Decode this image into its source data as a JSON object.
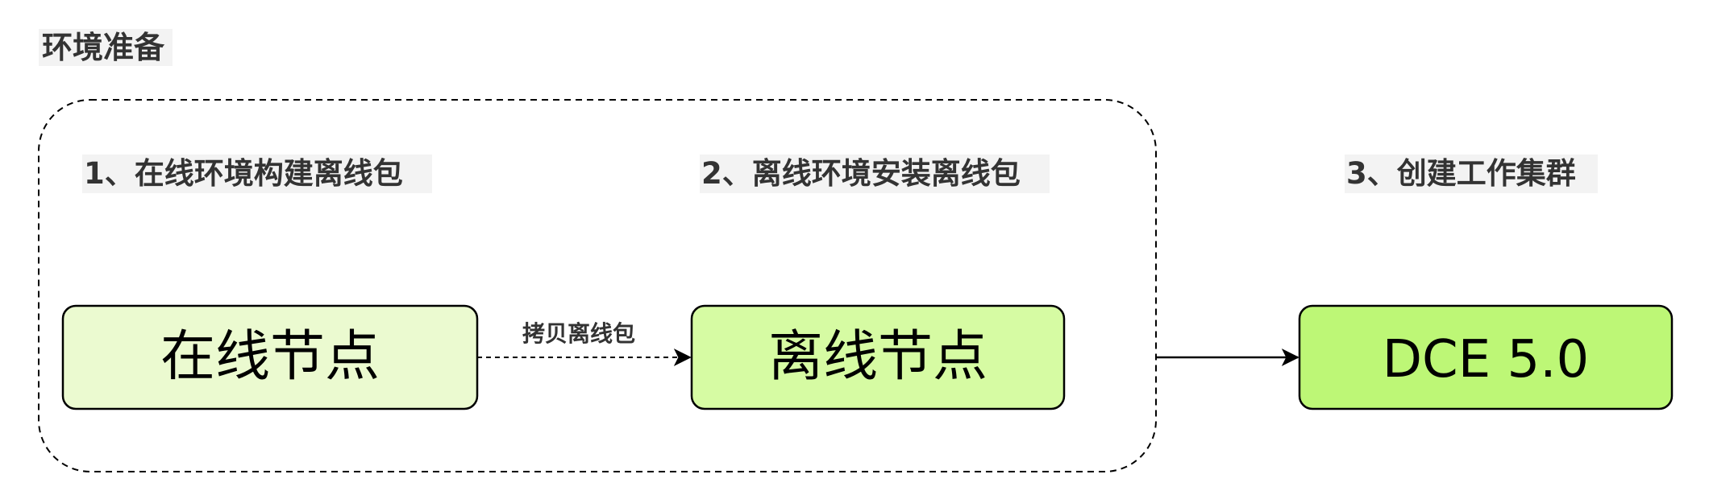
{
  "title": "环境准备",
  "steps": [
    {
      "label": "1、在线环境构建离线包"
    },
    {
      "label": "2、离线环境安装离线包"
    },
    {
      "label": "3、创建工作集群"
    }
  ],
  "nodes": [
    {
      "id": "online",
      "label": "在线节点",
      "fill": "#ebfad0"
    },
    {
      "id": "offline",
      "label": "离线节点",
      "fill": "#d6fba3"
    },
    {
      "id": "dce",
      "label": "DCE 5.0",
      "fill": "#bdf776"
    }
  ],
  "edges": [
    {
      "from": "online",
      "to": "offline",
      "label": "拷贝离线包",
      "style": "dashed"
    },
    {
      "from": "group",
      "to": "dce",
      "label": "",
      "style": "solid"
    }
  ],
  "colors": {
    "stroke": "#000000",
    "heading_text": "#333333",
    "label_background": "#f3f3f3"
  }
}
